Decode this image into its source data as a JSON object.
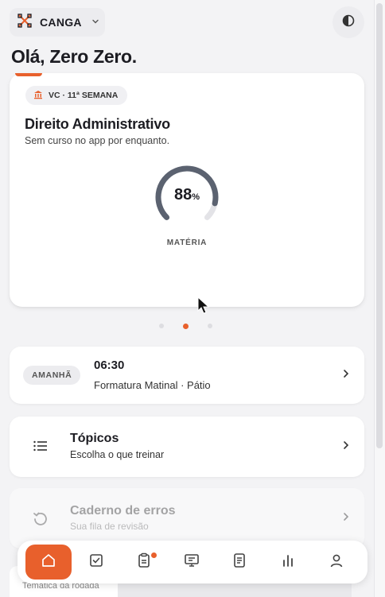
{
  "header": {
    "brand_name": "CANGA",
    "brand_icon": "crossed-swords-icon",
    "theme_icon": "contrast-icon"
  },
  "greeting": "Olá, Zero Zero.",
  "hero": {
    "week_tag": "VC · 11ª SEMANA",
    "subject_title": "Direito Administrativo",
    "subject_subtitle": "Sem curso no app por enquanto.",
    "progress_value": "88",
    "progress_unit": "%",
    "progress_fraction": 0.88,
    "progress_label": "MATÉRIA"
  },
  "carousel": {
    "count": 3,
    "active_index": 1
  },
  "schedule": {
    "day": "AMANHÃ",
    "time": "06:30",
    "description": "Formatura Matinal · Pátio"
  },
  "topics": {
    "title": "Tópicos",
    "subtitle": "Escolha o que treinar"
  },
  "errors": {
    "title": "Caderno de erros",
    "subtitle": "Sua fila de revisão"
  },
  "partial": {
    "text": "Temática da rodada"
  },
  "nav": {
    "items": [
      {
        "icon": "home-icon",
        "active": true
      },
      {
        "icon": "checklist-icon",
        "active": false
      },
      {
        "icon": "clipboard-icon",
        "active": false,
        "badge": true
      },
      {
        "icon": "monitor-icon",
        "active": false
      },
      {
        "icon": "document-icon",
        "active": false
      },
      {
        "icon": "bar-chart-icon",
        "active": false
      },
      {
        "icon": "user-icon",
        "active": false
      }
    ]
  },
  "colors": {
    "accent": "#e8602c",
    "background": "#f3f3f5",
    "card": "#ffffff",
    "gauge_track": "#e3e3e7",
    "gauge_fill": "#5b6270"
  }
}
